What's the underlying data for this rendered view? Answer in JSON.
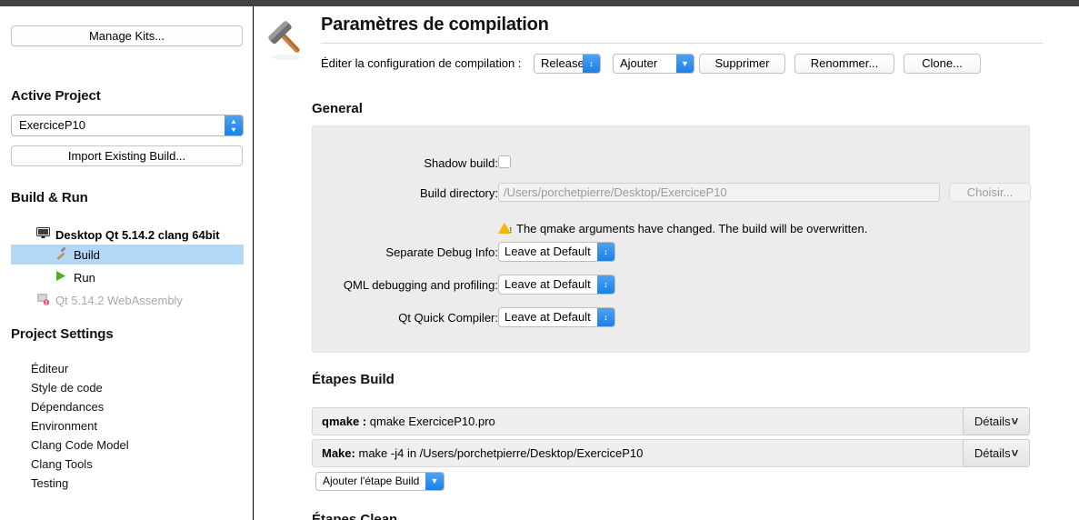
{
  "sidebar": {
    "manage_kits_label": "Manage Kits...",
    "active_project_heading": "Active Project",
    "active_project_value": "ExerciceP10",
    "import_existing_build_label": "Import Existing Build...",
    "build_run_heading": "Build & Run",
    "tree": [
      {
        "label": "Desktop Qt 5.14.2 clang 64bit",
        "icon": "desktop-monitor-icon"
      },
      {
        "label": "Build",
        "icon": "hammer-icon"
      },
      {
        "label": "Run",
        "icon": "play-triangle-icon"
      },
      {
        "label": "Qt 5.14.2 WebAssembly",
        "icon": "webassembly-error-icon"
      }
    ],
    "project_settings_heading": "Project Settings",
    "settings_items": [
      "Éditeur",
      "Style de code",
      "Dépendances",
      "Environment",
      "Clang Code Model",
      "Clang Tools",
      "Testing"
    ]
  },
  "header": {
    "title": "Paramètres de compilation",
    "icon": "hammer-icon",
    "edit_config_label": "Éditer la configuration de compilation :",
    "config_value": "Release",
    "add_label": "Ajouter",
    "remove_label": "Supprimer",
    "rename_label": "Renommer...",
    "clone_label": "Clone..."
  },
  "general": {
    "heading": "General",
    "shadow_build_label": "Shadow build:",
    "shadow_build_checked": false,
    "build_directory_label": "Build directory:",
    "build_directory_value": "/Users/porchetpierre/Desktop/ExerciceP10",
    "choose_label": "Choisir...",
    "warning_text": "The qmake arguments have changed. The build will be overwritten.",
    "warning_color": "#f2b705",
    "rows": [
      {
        "label": "Separate Debug Info:",
        "value": "Leave at Default"
      },
      {
        "label": "QML debugging and profiling:",
        "value": "Leave at Default"
      },
      {
        "label": "Qt Quick Compiler:",
        "value": "Leave at Default"
      }
    ]
  },
  "build_steps": {
    "heading": "Étapes Build",
    "steps": [
      {
        "name": "qmake :",
        "command": "qmake ExerciceP10.pro",
        "details_label": "Détails"
      },
      {
        "name": "Make:",
        "command": "make -j4 in /Users/porchetpierre/Desktop/ExerciceP10",
        "details_label": "Détails"
      }
    ],
    "add_step_label": "Ajouter l'étape Build"
  },
  "clean_steps": {
    "heading": "Étapes Clean"
  },
  "colors": {
    "accent_blue": "#1b80e8",
    "selection_blue": "#b2d8f7",
    "panel_gray": "#ececec",
    "titlebar": "#414141"
  }
}
